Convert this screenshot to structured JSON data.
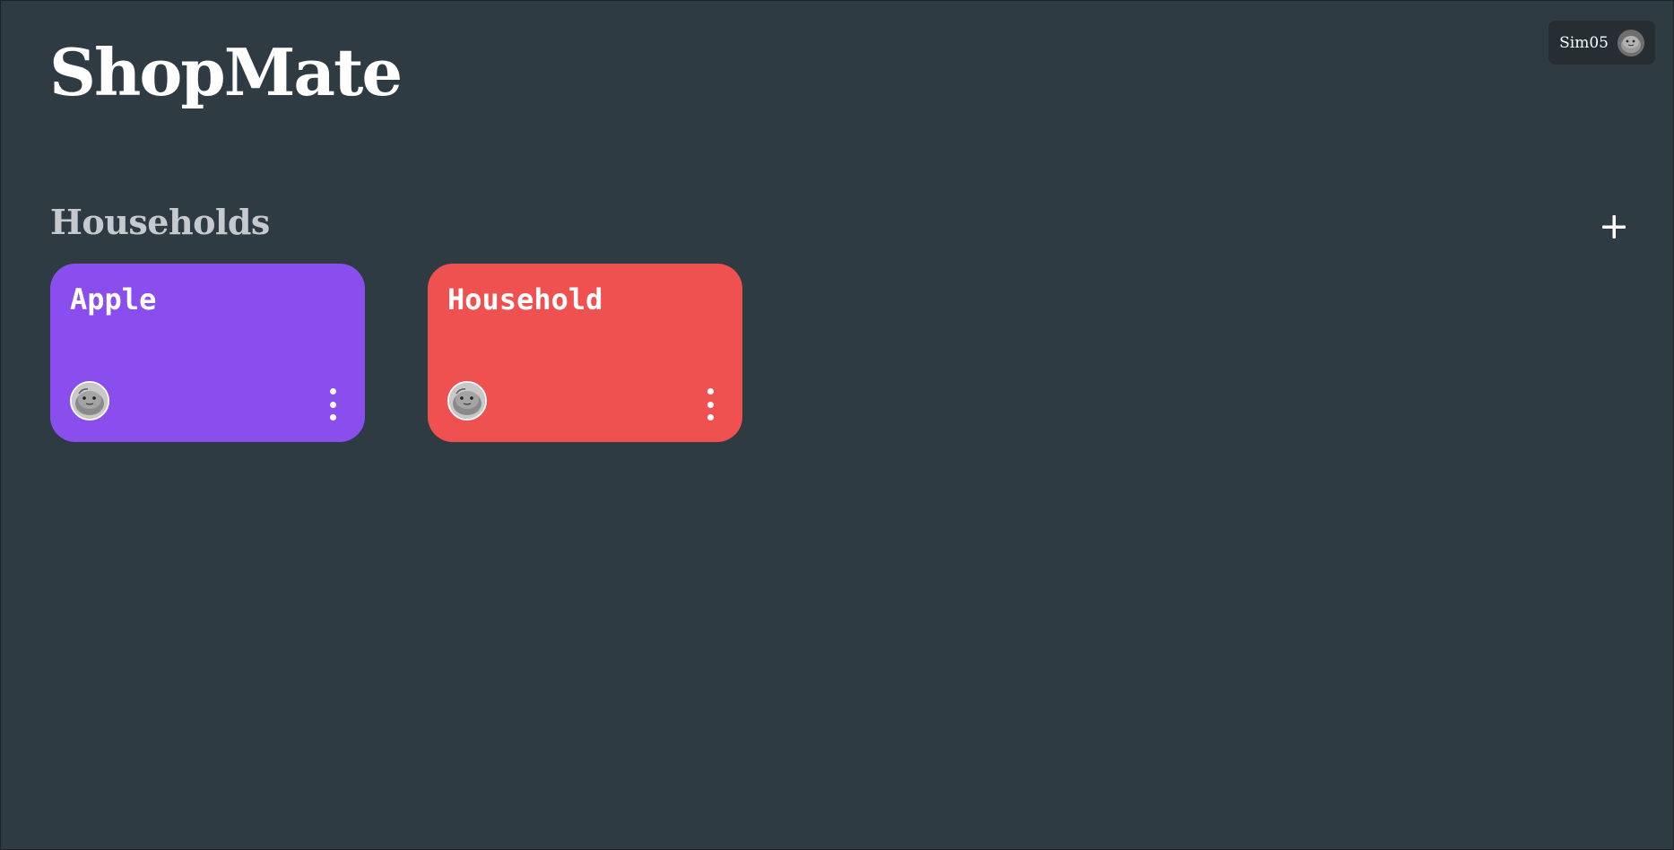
{
  "app": {
    "title": "ShopMate"
  },
  "user": {
    "name": "Sim05",
    "avatar_icon": "user-avatar"
  },
  "households_section": {
    "title": "Households",
    "add_icon": "plus-icon"
  },
  "households": [
    {
      "name": "Apple",
      "color": "#8b4eee",
      "member_avatar_icon": "member-avatar",
      "menu_icon": "more-vertical-icon"
    },
    {
      "name": "Household",
      "color": "#ef5050",
      "member_avatar_icon": "member-avatar",
      "menu_icon": "more-vertical-icon"
    }
  ],
  "colors": {
    "background": "#2f3b43",
    "chip_background": "#262e34",
    "section_title": "#c5cace",
    "text": "#ffffff"
  }
}
